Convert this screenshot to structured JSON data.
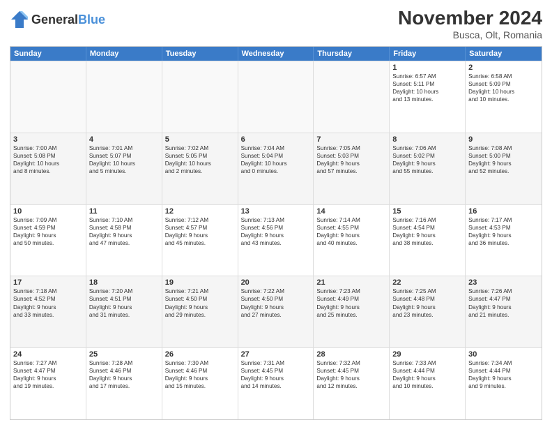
{
  "header": {
    "logo_general": "General",
    "logo_blue": "Blue",
    "title": "November 2024",
    "subtitle": "Busca, Olt, Romania"
  },
  "calendar": {
    "days": [
      "Sunday",
      "Monday",
      "Tuesday",
      "Wednesday",
      "Thursday",
      "Friday",
      "Saturday"
    ],
    "rows": [
      [
        {
          "day": "",
          "info": "",
          "empty": true
        },
        {
          "day": "",
          "info": "",
          "empty": true
        },
        {
          "day": "",
          "info": "",
          "empty": true
        },
        {
          "day": "",
          "info": "",
          "empty": true
        },
        {
          "day": "",
          "info": "",
          "empty": true
        },
        {
          "day": "1",
          "info": "Sunrise: 6:57 AM\nSunset: 5:11 PM\nDaylight: 10 hours\nand 13 minutes."
        },
        {
          "day": "2",
          "info": "Sunrise: 6:58 AM\nSunset: 5:09 PM\nDaylight: 10 hours\nand 10 minutes."
        }
      ],
      [
        {
          "day": "3",
          "info": "Sunrise: 7:00 AM\nSunset: 5:08 PM\nDaylight: 10 hours\nand 8 minutes."
        },
        {
          "day": "4",
          "info": "Sunrise: 7:01 AM\nSunset: 5:07 PM\nDaylight: 10 hours\nand 5 minutes."
        },
        {
          "day": "5",
          "info": "Sunrise: 7:02 AM\nSunset: 5:05 PM\nDaylight: 10 hours\nand 2 minutes."
        },
        {
          "day": "6",
          "info": "Sunrise: 7:04 AM\nSunset: 5:04 PM\nDaylight: 10 hours\nand 0 minutes."
        },
        {
          "day": "7",
          "info": "Sunrise: 7:05 AM\nSunset: 5:03 PM\nDaylight: 9 hours\nand 57 minutes."
        },
        {
          "day": "8",
          "info": "Sunrise: 7:06 AM\nSunset: 5:02 PM\nDaylight: 9 hours\nand 55 minutes."
        },
        {
          "day": "9",
          "info": "Sunrise: 7:08 AM\nSunset: 5:00 PM\nDaylight: 9 hours\nand 52 minutes."
        }
      ],
      [
        {
          "day": "10",
          "info": "Sunrise: 7:09 AM\nSunset: 4:59 PM\nDaylight: 9 hours\nand 50 minutes."
        },
        {
          "day": "11",
          "info": "Sunrise: 7:10 AM\nSunset: 4:58 PM\nDaylight: 9 hours\nand 47 minutes."
        },
        {
          "day": "12",
          "info": "Sunrise: 7:12 AM\nSunset: 4:57 PM\nDaylight: 9 hours\nand 45 minutes."
        },
        {
          "day": "13",
          "info": "Sunrise: 7:13 AM\nSunset: 4:56 PM\nDaylight: 9 hours\nand 43 minutes."
        },
        {
          "day": "14",
          "info": "Sunrise: 7:14 AM\nSunset: 4:55 PM\nDaylight: 9 hours\nand 40 minutes."
        },
        {
          "day": "15",
          "info": "Sunrise: 7:16 AM\nSunset: 4:54 PM\nDaylight: 9 hours\nand 38 minutes."
        },
        {
          "day": "16",
          "info": "Sunrise: 7:17 AM\nSunset: 4:53 PM\nDaylight: 9 hours\nand 36 minutes."
        }
      ],
      [
        {
          "day": "17",
          "info": "Sunrise: 7:18 AM\nSunset: 4:52 PM\nDaylight: 9 hours\nand 33 minutes."
        },
        {
          "day": "18",
          "info": "Sunrise: 7:20 AM\nSunset: 4:51 PM\nDaylight: 9 hours\nand 31 minutes."
        },
        {
          "day": "19",
          "info": "Sunrise: 7:21 AM\nSunset: 4:50 PM\nDaylight: 9 hours\nand 29 minutes."
        },
        {
          "day": "20",
          "info": "Sunrise: 7:22 AM\nSunset: 4:50 PM\nDaylight: 9 hours\nand 27 minutes."
        },
        {
          "day": "21",
          "info": "Sunrise: 7:23 AM\nSunset: 4:49 PM\nDaylight: 9 hours\nand 25 minutes."
        },
        {
          "day": "22",
          "info": "Sunrise: 7:25 AM\nSunset: 4:48 PM\nDaylight: 9 hours\nand 23 minutes."
        },
        {
          "day": "23",
          "info": "Sunrise: 7:26 AM\nSunset: 4:47 PM\nDaylight: 9 hours\nand 21 minutes."
        }
      ],
      [
        {
          "day": "24",
          "info": "Sunrise: 7:27 AM\nSunset: 4:47 PM\nDaylight: 9 hours\nand 19 minutes."
        },
        {
          "day": "25",
          "info": "Sunrise: 7:28 AM\nSunset: 4:46 PM\nDaylight: 9 hours\nand 17 minutes."
        },
        {
          "day": "26",
          "info": "Sunrise: 7:30 AM\nSunset: 4:46 PM\nDaylight: 9 hours\nand 15 minutes."
        },
        {
          "day": "27",
          "info": "Sunrise: 7:31 AM\nSunset: 4:45 PM\nDaylight: 9 hours\nand 14 minutes."
        },
        {
          "day": "28",
          "info": "Sunrise: 7:32 AM\nSunset: 4:45 PM\nDaylight: 9 hours\nand 12 minutes."
        },
        {
          "day": "29",
          "info": "Sunrise: 7:33 AM\nSunset: 4:44 PM\nDaylight: 9 hours\nand 10 minutes."
        },
        {
          "day": "30",
          "info": "Sunrise: 7:34 AM\nSunset: 4:44 PM\nDaylight: 9 hours\nand 9 minutes."
        }
      ]
    ]
  }
}
